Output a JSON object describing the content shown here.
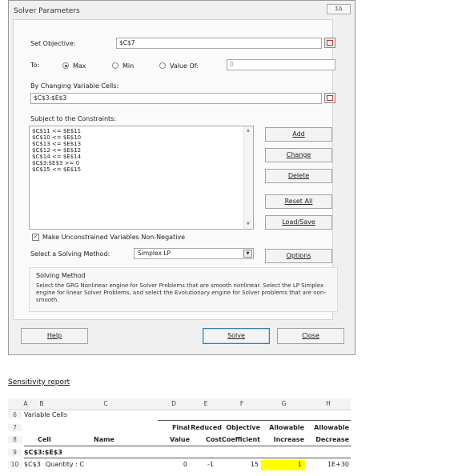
{
  "dialog": {
    "title": "Solver Parameters",
    "close_glyph": "ΣΔ",
    "objective": {
      "label": "Set Objective:",
      "value": "$C$7"
    },
    "to_label": "To:",
    "options": [
      {
        "label": "Max",
        "selected": true
      },
      {
        "label": "Min",
        "selected": false
      },
      {
        "label": "Value Of:",
        "selected": false
      }
    ],
    "value_of": "0",
    "changing_cells": {
      "label": "By Changing Variable Cells:",
      "value": "$C$3:$E$3"
    },
    "constraints_label": "Subject to the Constraints:",
    "constraints": [
      "$C$11 <= $E$11",
      "$C$10 <= $E$10",
      "$C$13 <= $E$13",
      "$C$12 <= $E$12",
      "$C$14 <= $E$14",
      "$C$3:$E$3 >= 0",
      "$C$15 <= $E$15"
    ],
    "buttons": {
      "add": "Add",
      "change": "Change",
      "delete": "Delete",
      "reset": "Reset All",
      "load": "Load/Save",
      "options": "Options",
      "help": "Help",
      "solve": "Solve",
      "close": "Close"
    },
    "nonneg": {
      "label": "Make Unconstrained Variables Non-Negative",
      "checked": true
    },
    "method": {
      "label": "Select a Solving Method:",
      "value": "Simplex LP"
    },
    "solving_method": {
      "title": "Solving Method",
      "text": "Select the GRG Nonlinear engine for Solver Problems that are smooth nonlinear. Select the LP Simplex engine for linear Solver Problems, and select the Evolutionary engine for Solver problems that are non-smooth."
    }
  },
  "report": {
    "heading": "Sensitivity report",
    "columns": [
      "A",
      "B",
      "C",
      "D",
      "E",
      "F",
      "G",
      "H"
    ],
    "row_numbers": [
      "6",
      "7",
      "8",
      "9",
      "10"
    ],
    "section": "Variable Cells",
    "header_top": {
      "d": "Final",
      "e": "Reduced",
      "f": "Objective",
      "g": "Allowable",
      "h": "Allowable"
    },
    "header_bottom": {
      "b": "Cell",
      "c": "Name",
      "d": "Value",
      "e": "Cost",
      "f": "Coefficient",
      "g": "Increase",
      "h": "Decrease"
    },
    "group_label": "$C$3:$E$3",
    "row": {
      "cell": "$C$3",
      "name": "Quantity : C",
      "value": "0",
      "cost": "-1",
      "coef": "15",
      "increase": "1",
      "decrease": "1E+30"
    },
    "highlight_color": "#ffff00"
  }
}
